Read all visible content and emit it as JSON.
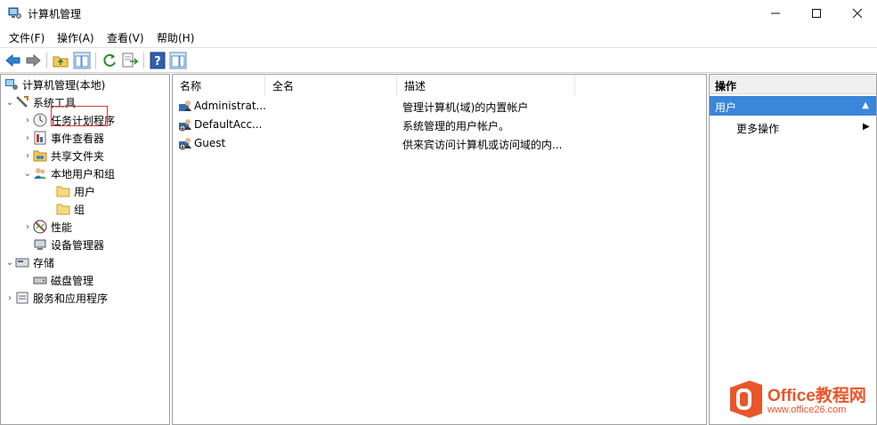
{
  "window": {
    "title": "计算机管理",
    "minimize": "—",
    "maximize": "☐",
    "close": "✕"
  },
  "menu": [
    "文件(F)",
    "操作(A)",
    "查看(V)",
    "帮助(H)"
  ],
  "tree": {
    "root": "计算机管理(本地)",
    "system_tools": "系统工具",
    "task_scheduler": "任务计划程序",
    "event_viewer": "事件查看器",
    "shared_folders": "共享文件夹",
    "local_users_groups": "本地用户和组",
    "users": "用户",
    "groups": "组",
    "performance": "性能",
    "device_manager": "设备管理器",
    "storage": "存储",
    "disk_management": "磁盘管理",
    "services_apps": "服务和应用程序"
  },
  "list": {
    "columns": [
      "名称",
      "全名",
      "描述"
    ],
    "rows": [
      {
        "name": "Administrat...",
        "fullname": "",
        "description": "管理计算机(域)的内置帐户"
      },
      {
        "name": "DefaultAcc...",
        "fullname": "",
        "description": "系统管理的用户帐户。"
      },
      {
        "name": "Guest",
        "fullname": "",
        "description": "供来宾访问计算机或访问域的内..."
      }
    ]
  },
  "actions": {
    "header": "操作",
    "section": "用户",
    "more": "更多操作"
  },
  "watermark": {
    "title": "Office教程网",
    "url": "www.office26.com"
  },
  "colors": {
    "selection": "#3a86d8",
    "highlight_border": "#d23a3a",
    "watermark": "#e8562a"
  }
}
